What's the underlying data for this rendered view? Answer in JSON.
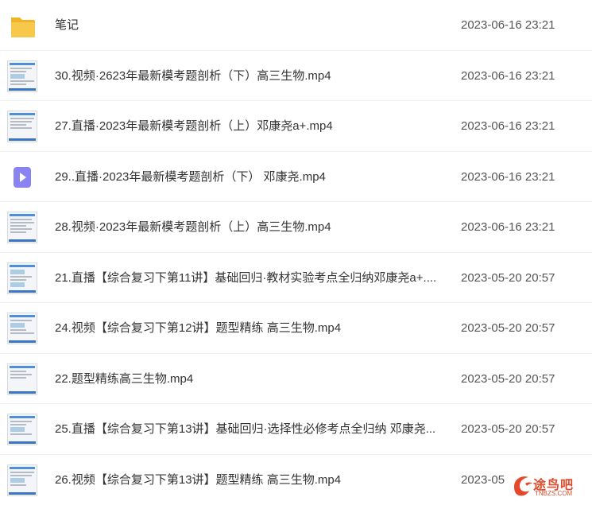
{
  "files": [
    {
      "name": "笔记",
      "date": "2023-06-16 23:21",
      "icon": "folder-icon"
    },
    {
      "name": "30.视频·2623年最新模考题剖析（下）高三生物.mp4",
      "date": "2023-06-16 23:21",
      "icon": "video-thumbnail"
    },
    {
      "name": "27.直播·2023年最新模考题剖析（上）邓康尧a+.mp4",
      "date": "2023-06-16 23:21",
      "icon": "video-thumbnail"
    },
    {
      "name": "29..直播·2023年最新模考题剖析（下） 邓康尧.mp4",
      "date": "2023-06-16 23:21",
      "icon": "video-file-icon"
    },
    {
      "name": "28.视频·2023年最新模考题剖析（上）高三生物.mp4",
      "date": "2023-06-16 23:21",
      "icon": "video-thumbnail"
    },
    {
      "name": "21.直播【综合复习下第11讲】基础回归·教材实验考点全归纳邓康尧a+....",
      "date": "2023-05-20 20:57",
      "icon": "video-thumbnail"
    },
    {
      "name": "24.视频【综合复习下第12讲】题型精练 高三生物.mp4",
      "date": "2023-05-20 20:57",
      "icon": "video-thumbnail"
    },
    {
      "name": "22.题型精练高三生物.mp4",
      "date": "2023-05-20 20:57",
      "icon": "video-thumbnail"
    },
    {
      "name": "25.直播【综合复习下第13讲】基础回归·选择性必修考点全归纳 邓康尧...",
      "date": "2023-05-20 20:57",
      "icon": "video-thumbnail"
    },
    {
      "name": "26.视频【综合复习下第13讲】题型精练 高三生物.mp4",
      "date": "2023-05",
      "icon": "video-thumbnail"
    }
  ],
  "watermark": {
    "text": "途鸟吧",
    "sub": "TNBZS.COM"
  },
  "colors": {
    "folder": "#f5c13d",
    "video_icon": "#8a83f2",
    "accent": "#4f8fd9"
  }
}
